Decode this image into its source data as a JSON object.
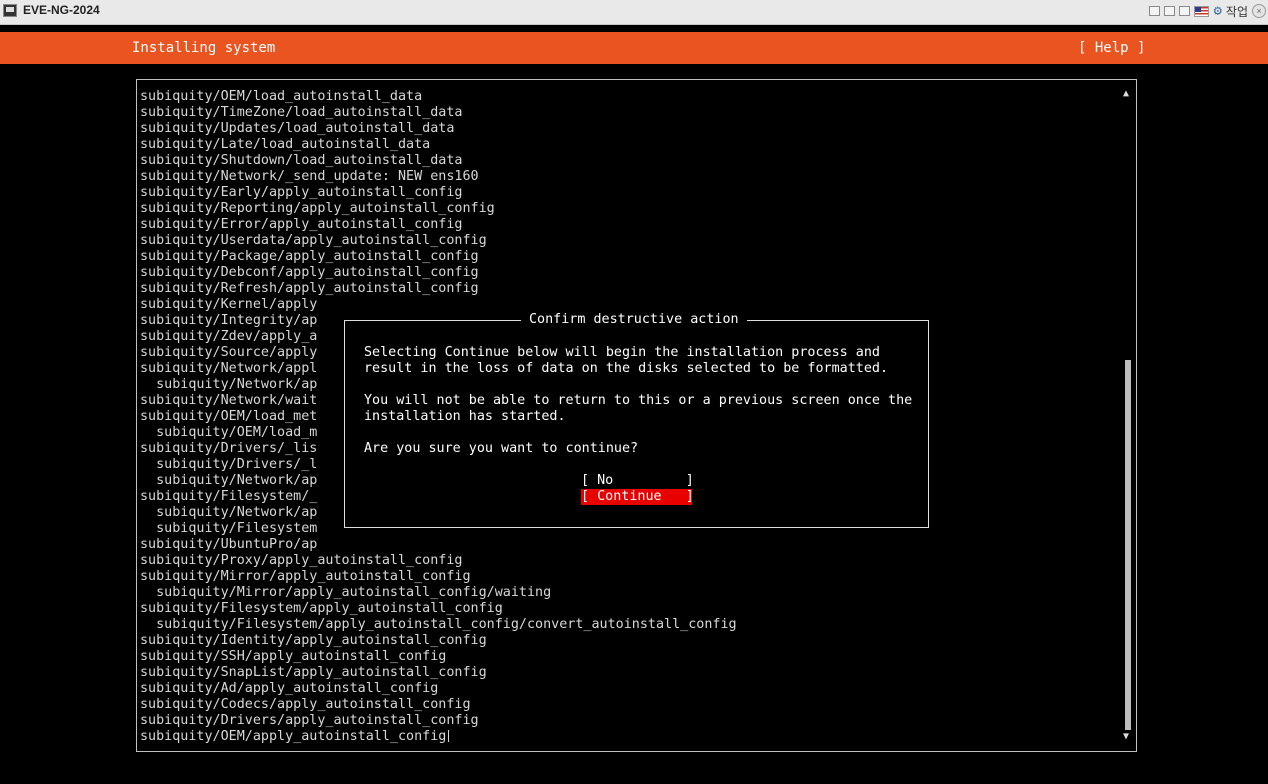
{
  "window": {
    "title": "EVE-NG-2024",
    "toolbar_label": "작업",
    "close_glyph": "×",
    "icons": [
      "window-icon",
      "box-icon",
      "box-icon",
      "box-icon",
      "us-flag-icon",
      "gear-icon",
      "close-icon"
    ]
  },
  "header": {
    "title": "Installing system",
    "help_label": "[ Help ]"
  },
  "log": {
    "lines": [
      "subiquity/OEM/load_autoinstall_data",
      "subiquity/TimeZone/load_autoinstall_data",
      "subiquity/Updates/load_autoinstall_data",
      "subiquity/Late/load_autoinstall_data",
      "subiquity/Shutdown/load_autoinstall_data",
      "subiquity/Network/_send_update: NEW ens160",
      "subiquity/Early/apply_autoinstall_config",
      "subiquity/Reporting/apply_autoinstall_config",
      "subiquity/Error/apply_autoinstall_config",
      "subiquity/Userdata/apply_autoinstall_config",
      "subiquity/Package/apply_autoinstall_config",
      "subiquity/Debconf/apply_autoinstall_config",
      "subiquity/Refresh/apply_autoinstall_config",
      "subiquity/Kernel/apply",
      "subiquity/Integrity/ap",
      "subiquity/Zdev/apply_a",
      "subiquity/Source/apply",
      "subiquity/Network/appl",
      "  subiquity/Network/ap",
      "subiquity/Network/wait",
      "subiquity/OEM/load_met",
      "  subiquity/OEM/load_m",
      "subiquity/Drivers/_lis",
      "  subiquity/Drivers/_l",
      "  subiquity/Network/ap",
      "subiquity/Filesystem/_",
      "  subiquity/Network/ap",
      "  subiquity/Filesystem",
      "subiquity/UbuntuPro/ap",
      "subiquity/Proxy/apply_autoinstall_config",
      "subiquity/Mirror/apply_autoinstall_config",
      "  subiquity/Mirror/apply_autoinstall_config/waiting",
      "subiquity/Filesystem/apply_autoinstall_config",
      "  subiquity/Filesystem/apply_autoinstall_config/convert_autoinstall_config",
      "subiquity/Identity/apply_autoinstall_config",
      "subiquity/SSH/apply_autoinstall_config",
      "subiquity/SnapList/apply_autoinstall_config",
      "subiquity/Ad/apply_autoinstall_config",
      "subiquity/Codecs/apply_autoinstall_config",
      "subiquity/Drivers/apply_autoinstall_config",
      "subiquity/OEM/apply_autoinstall_config"
    ],
    "scroll_up_glyph": "▲",
    "scroll_down_glyph": "▼"
  },
  "dialog": {
    "title": "Confirm destructive action",
    "paragraph1_line1": "Selecting Continue below will begin the installation process and",
    "paragraph1_line2": "result in the loss of data on the disks selected to be formatted.",
    "paragraph2_line1": "You will not be able to return to this or a previous screen once the",
    "paragraph2_line2": "installation has started.",
    "question": "Are you sure you want to continue?",
    "no_label": "[ No         ]",
    "continue_label": "[ Continue   ]"
  },
  "colors": {
    "accent": "#e95420",
    "focus": "#e80000",
    "background": "#000000"
  }
}
